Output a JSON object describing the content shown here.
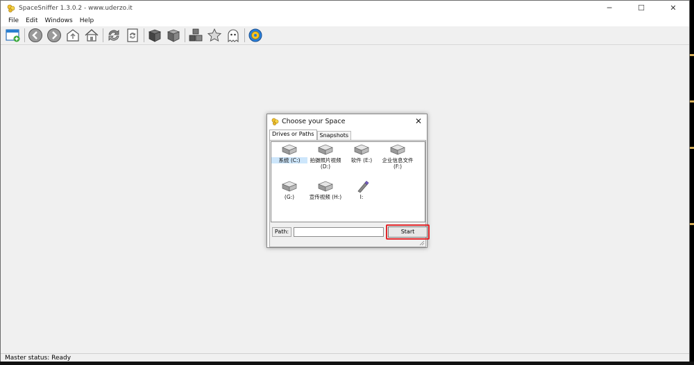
{
  "window": {
    "title": "SpaceSniffer 1.3.0.2 - www.uderzo.it",
    "controls": {
      "minimize": "─",
      "maximize": "☐",
      "close": "✕"
    }
  },
  "menu": [
    "File",
    "Edit",
    "Windows",
    "Help"
  ],
  "toolbar": {
    "buttons": [
      {
        "icon": "new-window-icon"
      },
      {
        "icon": "back-arrow-icon"
      },
      {
        "icon": "forward-arrow-icon"
      },
      {
        "icon": "parent-folder-icon"
      },
      {
        "icon": "home-icon"
      },
      {
        "icon": "refresh-icon"
      },
      {
        "icon": "refresh-page-icon"
      },
      {
        "icon": "box-dark-icon"
      },
      {
        "icon": "box-light-icon"
      },
      {
        "icon": "boxes-icon"
      },
      {
        "icon": "star-icon"
      },
      {
        "icon": "ghost-icon"
      },
      {
        "icon": "settings-gear-icon"
      }
    ]
  },
  "status": {
    "text": "Master status: Ready"
  },
  "dialog": {
    "title": "Choose your Space",
    "close": "✕",
    "tabs": [
      {
        "label": "Drives or Paths",
        "active": true
      },
      {
        "label": "Snapshots",
        "active": false
      }
    ],
    "drives": [
      {
        "label": "系统 (C:)",
        "selected": true,
        "type": "hdd"
      },
      {
        "label": "拍摄照片视频 (D:)",
        "selected": false,
        "type": "hdd"
      },
      {
        "label": "软件 (E:)",
        "selected": false,
        "type": "hdd"
      },
      {
        "label": "企业信息文件 (F:)",
        "selected": false,
        "type": "hdd"
      },
      {
        "label": "(G:)",
        "selected": false,
        "type": "hdd"
      },
      {
        "label": "宣传视频 (H:)",
        "selected": false,
        "type": "hdd"
      },
      {
        "label": "I:",
        "selected": false,
        "type": "usb"
      }
    ],
    "path_label": "Path:",
    "path_value": "",
    "start_label": "Start",
    "highlight_color": "#e0262a"
  }
}
